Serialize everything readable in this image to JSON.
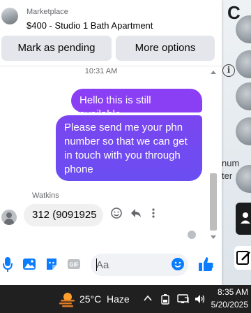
{
  "background": {
    "letter": "C",
    "text_line_1": "num",
    "text_line_2": "ter"
  },
  "header": {
    "source": "Marketplace",
    "title": "$400 - Studio 1 Bath Apartment"
  },
  "actions": {
    "mark_pending": "Mark as pending",
    "more_options": "More options"
  },
  "conversation": {
    "timestamp": "10:31 AM",
    "outgoing": [
      "Hello this is still available",
      "Please send me your phn number so that we can get in touch with you through phone"
    ],
    "sender_name": "Watkins",
    "incoming_text": "312 (9091925"
  },
  "composer": {
    "placeholder": "Aa"
  },
  "taskbar": {
    "temperature": "25°C",
    "condition": "Haze",
    "time": "8:35 AM",
    "date": "5/20/2025"
  },
  "colors": {
    "bubble_top": "#8a3ff5",
    "bubble_bottom": "#6a4ef2",
    "messenger_blue": "#0a7cff",
    "taskbar_bg": "#202020"
  }
}
